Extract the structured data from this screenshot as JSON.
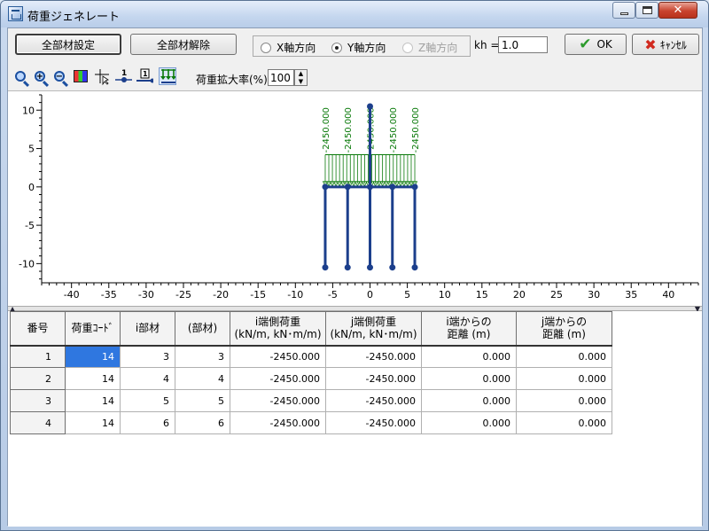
{
  "window": {
    "title": "荷重ジェネレート",
    "close_glyph": "✕"
  },
  "toolbar": {
    "select_all": "全部材設定",
    "deselect_all": "全部材解除",
    "direction_x": "X軸方向",
    "direction_y": "Y軸方向",
    "direction_z": "Z軸方向",
    "selected_direction": "Y軸方向",
    "kh_label": "kh =",
    "kh_value": "1.0",
    "ok": "OK",
    "cancel": "ｷｬﾝｾﾙ",
    "zoom_label": "荷重拡大率(%)",
    "zoom_value": "100"
  },
  "icons": [
    "zoom-fit-icon",
    "zoom-in-icon",
    "zoom-out-icon",
    "color-icon",
    "cursor-cross-icon",
    "node-number-icon",
    "member-number-icon",
    "load-display-icon"
  ],
  "chart_data": {
    "type": "structure-plot",
    "x_ticks": [
      -40,
      -35,
      -30,
      -25,
      -20,
      -15,
      -10,
      -5,
      0,
      5,
      10,
      15,
      20,
      25,
      30,
      35,
      40
    ],
    "y_ticks": [
      10,
      5,
      0,
      -5,
      -10
    ],
    "xlim": [
      -44,
      44
    ],
    "ylim": [
      -12.5,
      12
    ],
    "piles_x": [
      -6,
      -3,
      0,
      3,
      6
    ],
    "pile_top_y": 0,
    "pile_bottom_y": -10.5,
    "center_post_top_y": 10.5,
    "load_top_y": 4.2,
    "load_x_range": [
      -6,
      6
    ],
    "load_labels": [
      "-2450.000",
      "-2450.000",
      "-2450.000",
      "-2450.000",
      "-2450.000"
    ],
    "member_color": "#1c3f8c",
    "load_color": "#0a7a0a"
  },
  "table": {
    "headers": [
      "番号",
      "荷重ｺｰﾄﾞ",
      "i部材",
      "(部材)",
      "i端側荷重\n(kN/m, kN･m/m)",
      "j端側荷重\n(kN/m, kN･m/m)",
      "i端からの\n距離 (m)",
      "j端からの\n距離 (m)"
    ],
    "rows": [
      [
        "1",
        "14",
        "3",
        "3",
        "-2450.000",
        "-2450.000",
        "0.000",
        "0.000"
      ],
      [
        "2",
        "14",
        "4",
        "4",
        "-2450.000",
        "-2450.000",
        "0.000",
        "0.000"
      ],
      [
        "3",
        "14",
        "5",
        "5",
        "-2450.000",
        "-2450.000",
        "0.000",
        "0.000"
      ],
      [
        "4",
        "14",
        "6",
        "6",
        "-2450.000",
        "-2450.000",
        "0.000",
        "0.000"
      ]
    ]
  }
}
